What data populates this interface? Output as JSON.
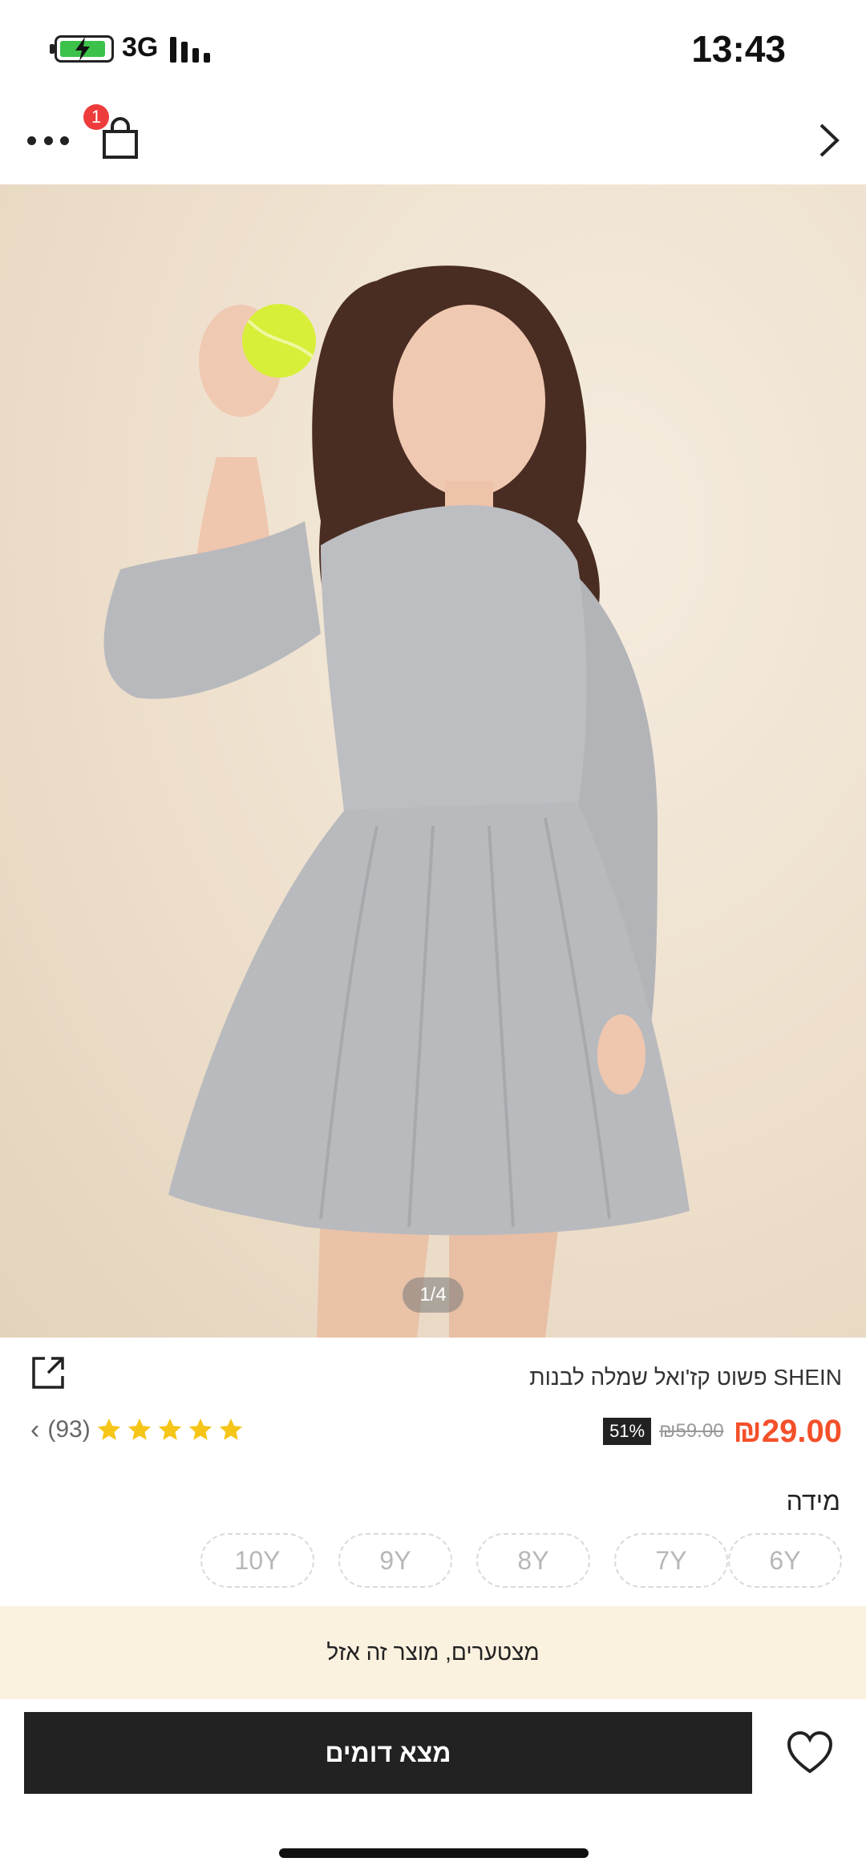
{
  "status_bar": {
    "time": "13:43",
    "network": "3G"
  },
  "nav": {
    "cart_count": "1"
  },
  "gallery": {
    "page_indicator": "1/4"
  },
  "product": {
    "title": "SHEIN פשוט קז'ואל שמלה לבנות",
    "rating_count": "(93)",
    "rating_stars": 5,
    "discount": "51%",
    "old_price": "₪59.00",
    "sale_price": "₪29.00"
  },
  "size": {
    "label": "מידה",
    "options": [
      "6Y",
      "7Y",
      "8Y",
      "9Y",
      "10Y"
    ]
  },
  "banner": {
    "sold_out_text": "מצטערים, מוצר זה אזל"
  },
  "actions": {
    "find_similar_label": "מצא דומים"
  },
  "colors": {
    "sale": "#f4502a",
    "badge": "#ee3b3b",
    "star": "#f5c518",
    "banner_bg": "#fbf1df"
  }
}
